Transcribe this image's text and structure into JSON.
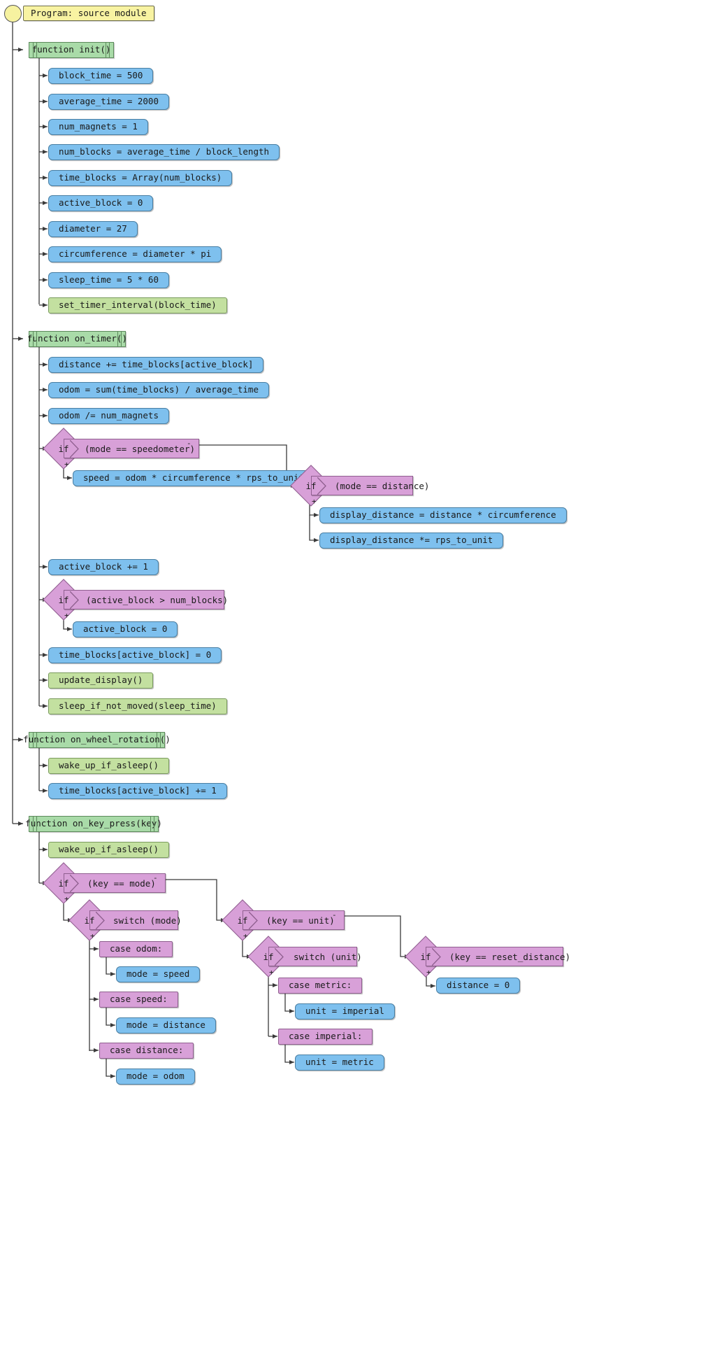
{
  "diagram": {
    "type": "code-flowchart",
    "title": "Program: source module",
    "colors": {
      "start": "#f8f3a2",
      "function_header": "#a9dba8",
      "assignment": "#7ec0ee",
      "call": "#c3e0a0",
      "conditional": "#d8a0d8",
      "edge": "#404040",
      "background": "#ffffff"
    },
    "branch_labels": {
      "true": "+",
      "false": "-"
    },
    "nodes": {
      "root": "Program: source module",
      "fn_init": "function init()",
      "init_1": "block_time = 500",
      "init_2": "average_time = 2000",
      "init_3": "num_magnets = 1",
      "init_4": "num_blocks = average_time / block_length",
      "init_5": "time_blocks = Array(num_blocks)",
      "init_6": "active_block = 0",
      "init_7": "diameter = 27",
      "init_8": "circumference = diameter * pi",
      "init_9": "sleep_time = 5 * 60",
      "init_10": "set_timer_interval(block_time)",
      "fn_on_timer": "function on_timer()",
      "tim_1": "distance += time_blocks[active_block]",
      "tim_2": "odom = sum(time_blocks) / average_time",
      "tim_3": "odom /= num_magnets",
      "tim_if_speed_kw": "if",
      "tim_if_speed_cond": "(mode == speedometer)",
      "tim_speed_body": "speed = odom * circumference * rps_to_unit",
      "tim_if_dist_kw": "if",
      "tim_if_dist_cond": "(mode == distance)",
      "tim_dist_body_1": "display_distance = distance * circumference",
      "tim_dist_body_2": "display_distance *= rps_to_unit",
      "tim_4": "active_block += 1",
      "tim_if_block_kw": "if",
      "tim_if_block_cond": "(active_block > num_blocks)",
      "tim_block_body": "active_block = 0",
      "tim_5": "time_blocks[active_block] = 0",
      "tim_6": "update_display()",
      "tim_7": "sleep_if_not_moved(sleep_time)",
      "fn_on_wheel": "function on_wheel_rotation()",
      "whl_1": "wake_up_if_asleep()",
      "whl_2": "time_blocks[active_block] += 1",
      "fn_on_key": "function on_key_press(key)",
      "key_1": "wake_up_if_asleep()",
      "key_if_mode_kw": "if",
      "key_if_mode_cond": "(key == mode)",
      "key_sw_mode_kw": "if",
      "key_sw_mode_cond": "switch (mode)",
      "case_odom": "case odom:",
      "case_odom_body": "mode = speed",
      "case_speed": "case speed:",
      "case_speed_body": "mode = distance",
      "case_distance": "case distance:",
      "case_distance_body": "mode = odom",
      "key_if_unit_kw": "if",
      "key_if_unit_cond": "(key == unit)",
      "key_sw_unit_kw": "if",
      "key_sw_unit_cond": "switch (unit)",
      "case_metric": "case metric:",
      "case_metric_body": "unit = imperial",
      "case_imperial": "case imperial:",
      "case_imperial_body": "unit = metric",
      "key_if_reset_kw": "if",
      "key_if_reset_cond": "(key == reset_distance)",
      "key_reset_body": "distance = 0"
    }
  }
}
